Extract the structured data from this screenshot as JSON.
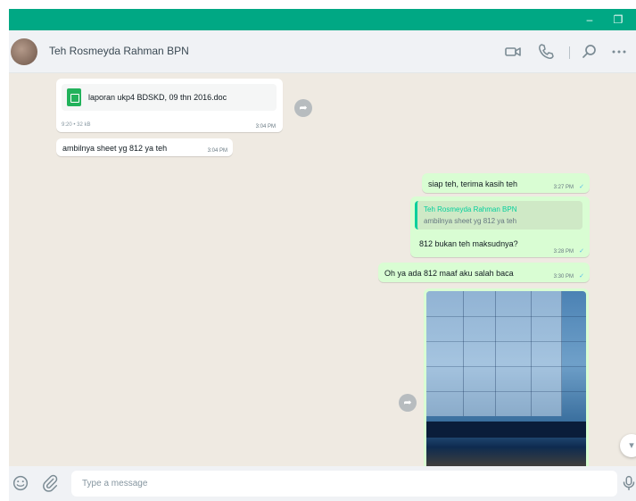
{
  "window": {
    "minimize_glyph": "–",
    "maximize_glyph": "❐"
  },
  "header": {
    "contact_name": "Teh Rosmeyda Rahman BPN",
    "icons": [
      "video-call-icon",
      "voice-call-icon",
      "search-icon",
      "menu-icon"
    ]
  },
  "messages": {
    "document": {
      "file_name": "laporan ukp4 BDSKD, 09 thn 2016.doc",
      "meta": "9:20 • 32 kB",
      "time": "3:04 PM"
    },
    "incoming_text": {
      "text": "ambilnya sheet yg 812 ya teh",
      "time": "3:04 PM"
    },
    "outgoing": [
      {
        "text": "siap teh, terima kasih teh",
        "time": "3:27 PM"
      },
      {
        "text": "812 bukan teh maksudnya?",
        "time": "3:28 PM"
      },
      {
        "text": "Oh ya ada 812 maaf aku salah baca",
        "time": "3:30 PM"
      }
    ],
    "reply_quote": {
      "author": "Teh Rosmeyda Rahman BPN",
      "text": "ambilnya sheet yg 812 ya teh"
    },
    "status_check": "✓"
  },
  "footer": {
    "input_placeholder": "Type a message"
  },
  "colors": {
    "accent": "#00a884",
    "chat_background": "#efeae2",
    "outgoing_bubble": "#d9fdd3",
    "incoming_bubble": "#ffffff"
  }
}
